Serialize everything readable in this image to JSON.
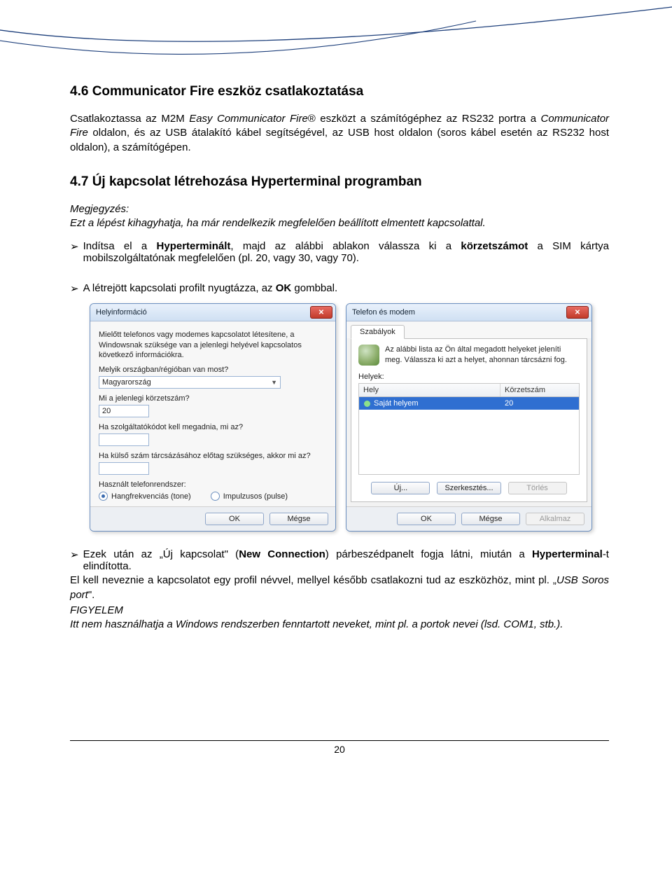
{
  "section46": {
    "heading": "4.6 Communicator Fire eszköz csatlakoztatása",
    "p1a": "Csatlakoztassa az M2M ",
    "p1b": "Easy Communicator Fire",
    "p1c": "® eszközt a számítógéphez az RS232 portra a ",
    "p1d": "Communicator Fire",
    "p1e": " oldalon, és az USB átalakító kábel segítségével, az USB host oldalon (soros kábel esetén az RS232 host oldalon), a számítógépen."
  },
  "section47": {
    "heading": "4.7 Új kapcsolat létrehozása Hyperterminal programban",
    "note_label": "Megjegyzés:",
    "note_body": "Ezt a lépést kihagyhatja, ha már rendelkezik megfelelően beállított elmentett kapcsolattal.",
    "bullet1_mark": "➢",
    "bullet1_a": " Indítsa el a ",
    "bullet1_b": "Hyperterminált",
    "bullet1_c": ", majd az alábbi ablakon válassza ki a ",
    "bullet1_d": "körzetszámot",
    "bullet1_e": " a SIM kártya mobilszolgáltatónak megfelelően (pl. 20, vagy 30, vagy 70).",
    "bullet2_mark": "➢",
    "bullet2_a": " A létrejött kapcsolati profilt nyugtázza, az ",
    "bullet2_b": "OK",
    "bullet2_c": " gombbal.",
    "bullet3_mark": "➢",
    "bullet3_a": " Ezek után az „Új kapcsolat\" (",
    "bullet3_b": "New Connection",
    "bullet3_c": ") párbeszédpanelt fogja látni, miután a ",
    "bullet3_d": "Hyperterminal",
    "bullet3_e": "-t elindította.",
    "after3_a": "El kell neveznie a kapcsolatot egy profil névvel, mellyel később csatlakozni tud az eszközhöz, mint pl. „",
    "after3_b": "USB Soros port",
    "after3_c": "\".",
    "warn_label": "FIGYELEM",
    "warn_body": "Itt nem használhatja a Windows rendszerben fenntartott neveket, mint pl. a portok nevei (lsd. COM1, stb.)."
  },
  "dialog1": {
    "title": "Helyinformáció",
    "intro": "Mielőtt telefonos vagy modemes kapcsolatot létesítene, a Windowsnak szüksége van a jelenlegi helyével kapcsolatos következő információkra.",
    "q_country": "Melyik országban/régióban van most?",
    "country_value": "Magyarország",
    "q_area": "Mi a jelenlegi körzetszám?",
    "area_value": "20",
    "q_carrier": "Ha szolgáltatókódot kell megadnia, mi az?",
    "carrier_value": "",
    "q_prefix": "Ha külső szám tárcsázásához előtag szükséges, akkor mi az?",
    "prefix_value": "",
    "q_system": "Használt telefonrendszer:",
    "radio_tone": "Hangfrekvenciás (tone)",
    "radio_pulse": "Impulzusos (pulse)",
    "btn_ok": "OK",
    "btn_cancel": "Mégse"
  },
  "dialog2": {
    "title": "Telefon és modem",
    "tab": "Szabályok",
    "intro": "Az alábbi lista az Ön által megadott helyeket jeleníti meg. Válassza ki azt a helyet, ahonnan tárcsázni fog.",
    "list_label": "Helyek:",
    "col_a": "Hely",
    "col_b": "Körzetszám",
    "row_a": "Saját helyem",
    "row_b": "20",
    "btn_new": "Új...",
    "btn_edit": "Szerkesztés...",
    "btn_del": "Törlés",
    "btn_ok": "OK",
    "btn_cancel": "Mégse",
    "btn_apply": "Alkalmaz"
  },
  "page_number": "20"
}
